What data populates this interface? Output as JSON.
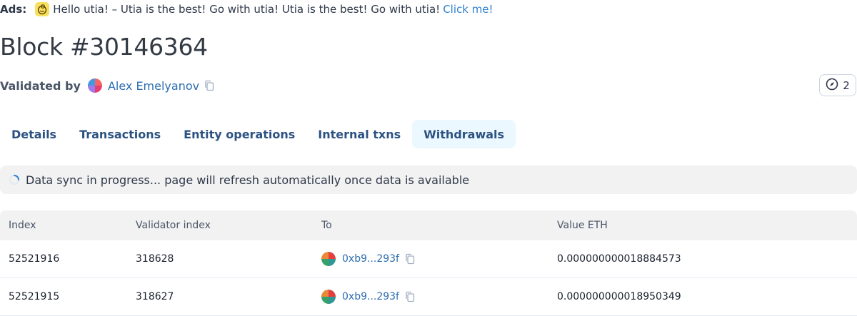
{
  "ads": {
    "label": "Ads:",
    "text": "Hello utia! – Utia is the best! Go with utia! Utia is the best! Go with utia!",
    "link": "Click me!"
  },
  "page": {
    "title": "Block #30146364"
  },
  "validator": {
    "label": "Validated by",
    "name": "Alex Emelyanov"
  },
  "badge": {
    "count": "2"
  },
  "tabs": [
    {
      "label": "Details"
    },
    {
      "label": "Transactions"
    },
    {
      "label": "Entity operations"
    },
    {
      "label": "Internal txns"
    },
    {
      "label": "Withdrawals",
      "active": true
    }
  ],
  "sync": {
    "message": "Data sync in progress... page will refresh automatically once data is available"
  },
  "table": {
    "headers": [
      "Index",
      "Validator index",
      "To",
      "Value ETH"
    ],
    "rows": [
      {
        "index": "52521916",
        "validator_index": "318628",
        "to": "0xb9...293f",
        "value": "0.000000000018884573"
      },
      {
        "index": "52521915",
        "validator_index": "318627",
        "to": "0xb9...293f",
        "value": "0.000000000018950349"
      }
    ]
  },
  "colors": {
    "link": "#2b6cb0",
    "active_tab_bg": "#ebf8ff",
    "banner_bg": "#f2f2f2"
  }
}
